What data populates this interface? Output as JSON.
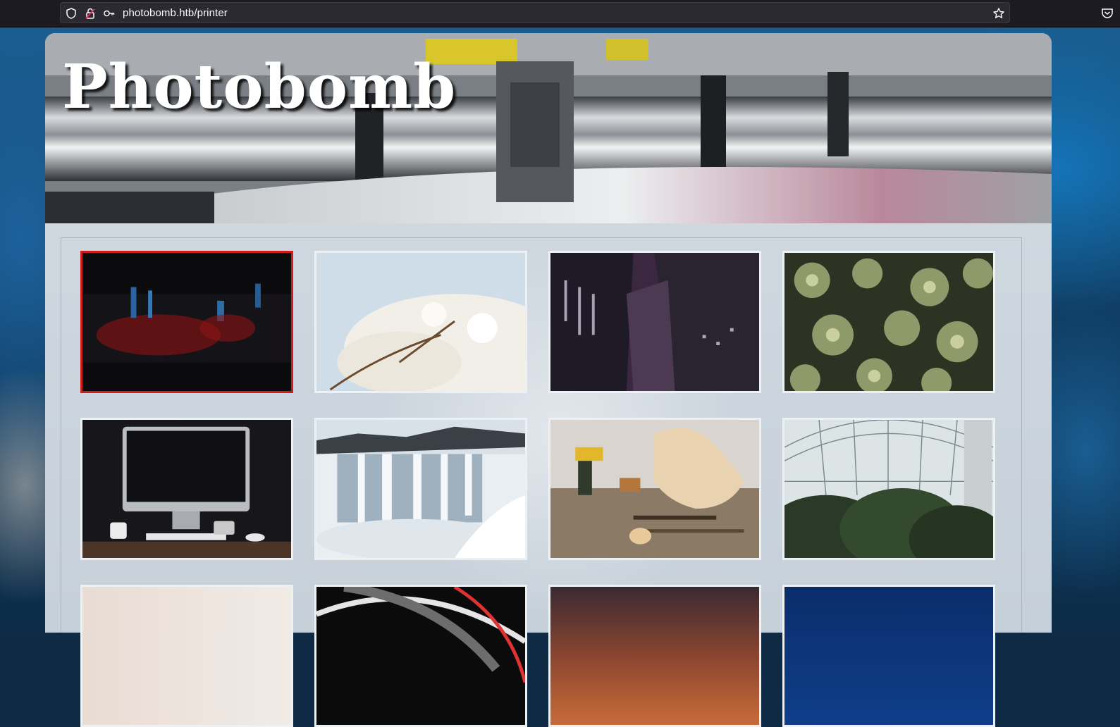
{
  "browser": {
    "url": "photobomb.htb/printer",
    "icons": [
      "shield-icon",
      "lock-warning-icon",
      "key-icon",
      "bookmark-star-icon",
      "pocket-icon"
    ]
  },
  "site": {
    "title": "Photobomb",
    "banner_image": "printing-press-photo"
  },
  "gallery": {
    "selected_index": 0,
    "images": [
      {
        "subject": "dark-red-blue-lights"
      },
      {
        "subject": "white-magnolia-blossoms"
      },
      {
        "subject": "purple-skyscrapers-looking-up"
      },
      {
        "subject": "green-succulent-plants"
      },
      {
        "subject": "desktop-computer-on-desk"
      },
      {
        "subject": "frozen-waterfall"
      },
      {
        "subject": "woodworking-workshop-guitar-body"
      },
      {
        "subject": "glass-greenhouse-with-palms"
      },
      {
        "subject": "pale-gradient"
      },
      {
        "subject": "black-car-curve"
      },
      {
        "subject": "sunset-sky"
      },
      {
        "subject": "deep-blue"
      }
    ]
  },
  "colors": {
    "selected_border": "#d11a1a",
    "thumb_border": "#eef1f4",
    "title_text": "#ffffff"
  }
}
